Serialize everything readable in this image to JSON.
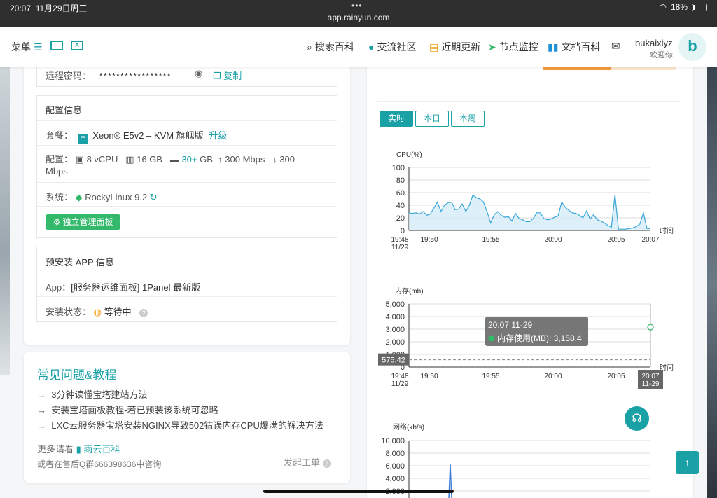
{
  "status_bar": {
    "time": "20:07",
    "date": "11月29日周三",
    "url": "app.rainyun.com",
    "battery": "18%"
  },
  "header": {
    "menu_label": "菜单",
    "nav": [
      {
        "label": "搜索百科",
        "icon": "search-icon"
      },
      {
        "label": "交流社区",
        "icon": "community-icon"
      },
      {
        "label": "近期更新",
        "icon": "updates-icon"
      },
      {
        "label": "节点监控",
        "icon": "monitor-icon"
      },
      {
        "label": "文档百科",
        "icon": "book-icon"
      }
    ],
    "user_name": "bukaixiyz",
    "user_greeting": "欢迎你",
    "avatar_letter": "b"
  },
  "server": {
    "password_label": "远程密码：",
    "password_value": "*****************",
    "copy_label": "复制",
    "config_title": "配置信息",
    "plan_label": "套餐：",
    "plan_badge": "E5",
    "plan_value": "Xeon® E5v2 – KVM 旗舰版",
    "upgrade_label": "升级",
    "spec_label": "配置：",
    "cpu": "8 vCPU",
    "ram": "16 GB",
    "disk_prefix": "30+",
    "disk_unit": "GB",
    "up_speed": "↑ 300 Mbps",
    "down_speed": "↓ 300",
    "down_unit": "Mbps",
    "system_label": "系统：",
    "system_value": "RockyLinux 9.2",
    "panel_button": "独立管理面板",
    "app_title": "预安装 APP 信息",
    "app_label": "App：",
    "app_value": "[服务器运维面板] 1Panel 最新版",
    "install_label": "安装状态：",
    "install_value": "等待中"
  },
  "faq": {
    "title": "常见问题&教程",
    "items": [
      "3分钟读懂宝塔建站方法",
      "安装宝塔面板教程-若已预装该系统可忽略",
      "LXC云服务器宝塔安装NGINX导致502错误内存CPU爆满的解决方法"
    ],
    "more_prefix": "更多请看",
    "more_link": "雨云百科",
    "qq_text": "或者在售后Q群666398636中咨询",
    "ticket_label": "发起工单"
  },
  "monitor_tabs": [
    "实时",
    "本日",
    "本周"
  ],
  "chart_data": [
    {
      "type": "area",
      "title": "CPU(%)",
      "xlabel": "时间",
      "ylim": [
        0,
        100
      ],
      "yticks": [
        0,
        20,
        40,
        60,
        80,
        100
      ],
      "xticks": [
        "19:48\n11/29",
        "19:50",
        "19:55",
        "20:00",
        "20:05",
        "20:07"
      ],
      "x_range_min": [
        0,
        19
      ],
      "values": [
        28,
        27,
        28,
        26,
        30,
        24,
        26,
        35,
        45,
        30,
        40,
        44,
        45,
        33,
        34,
        42,
        30,
        40,
        56,
        52,
        50,
        45,
        30,
        12,
        25,
        30,
        24,
        21,
        22,
        15,
        27,
        19,
        17,
        14,
        14,
        19,
        28,
        28,
        19,
        17,
        18,
        21,
        23,
        45,
        37,
        32,
        28,
        27,
        24,
        20,
        31,
        18,
        25,
        17,
        15,
        12,
        8,
        5,
        57,
        2,
        2,
        2,
        3,
        4,
        6,
        10,
        28,
        3,
        3
      ]
    },
    {
      "type": "line",
      "title": "内存(mb)",
      "xlabel": "时间",
      "ylim": [
        0,
        5000
      ],
      "yticks": [
        "0",
        "1,000",
        "2,000",
        "3,000",
        "4,000",
        "5,000"
      ],
      "xticks": [
        "19:48\n11/29",
        "19:50",
        "19:55",
        "20:00",
        "20:05",
        "20:07"
      ],
      "reference_value": "575.42",
      "tooltip_time": "20:07 11-29",
      "tooltip_series": "内存使用(MB):",
      "tooltip_value": "3,158.4",
      "cursor_label": "20:07\n11-29"
    },
    {
      "type": "line",
      "title": "网络(kb/s)",
      "ylim": [
        0,
        10000
      ],
      "yticks": [
        "2,000",
        "4,000",
        "6,000",
        "8,000",
        "10,000"
      ],
      "peak_value": 6200
    }
  ]
}
